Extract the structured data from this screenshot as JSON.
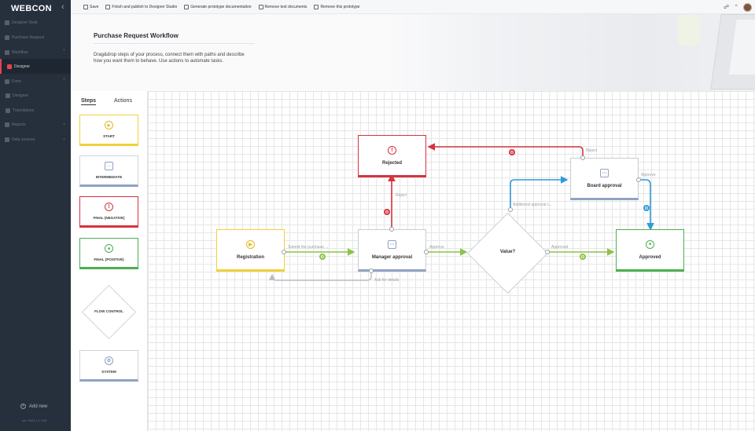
{
  "brand": {
    "logo": "WEBCON"
  },
  "sidebar": {
    "items": [
      {
        "label": "Designer Desk",
        "chevron": ""
      },
      {
        "label": "Purchase Request",
        "chevron": ""
      },
      {
        "label": "Workflow",
        "chevron": "^"
      },
      {
        "label": "Designer",
        "chevron": ""
      },
      {
        "label": "Form",
        "chevron": "^"
      },
      {
        "label": "Designer",
        "chevron": ""
      },
      {
        "label": "Translations",
        "chevron": ""
      },
      {
        "label": "Reports",
        "chevron": "v"
      },
      {
        "label": "Data sources",
        "chevron": "v"
      }
    ],
    "add_new": "Add new",
    "version": "ver. 2023.1.2.158"
  },
  "toolbar": {
    "save": "Save",
    "finish": "Finish and publish to Designer Studio",
    "generate": "Generate prototype documentation",
    "remove_docs": "Remove test documents",
    "remove_proto": "Remove this prototype"
  },
  "header": {
    "title": "Purchase Request Workflow",
    "description": "Drag&drop steps of your process, connect them with paths and describe how you want them to behave. Use actions to automate tasks."
  },
  "palette": {
    "tabs": [
      "Steps",
      "Actions"
    ],
    "items": [
      {
        "label": "START",
        "color": "#f2d03b"
      },
      {
        "label": "INTERMEDIATE",
        "color": "#8fa3c4"
      },
      {
        "label": "FINAL (NEGATIVE)",
        "color": "#d6333f"
      },
      {
        "label": "FINAL (POSITIVE)",
        "color": "#4caf50"
      },
      {
        "label": "FLOW CONTROL",
        "color": "#cfd3d8"
      },
      {
        "label": "SYSTEM",
        "color": "#8fa3c4"
      }
    ]
  },
  "workflow": {
    "nodes": {
      "registration": "Registration",
      "manager": "Manager approval",
      "rejected": "Rejected",
      "value": "Value?",
      "board": "Board approval",
      "approved": "Approved"
    },
    "edges": {
      "submit": "Submit the purchase ...",
      "approve1": "Approve",
      "reject1": "Reject",
      "ask": "Ask for details",
      "additional": "Additional approval r...",
      "approved_path": "Approved",
      "reject2": "Reject",
      "approve2": "Approve"
    },
    "colors": {
      "green": "#8bc34a",
      "red": "#d6333f",
      "blue": "#2f9ad6",
      "gray": "#b9bec4"
    }
  }
}
